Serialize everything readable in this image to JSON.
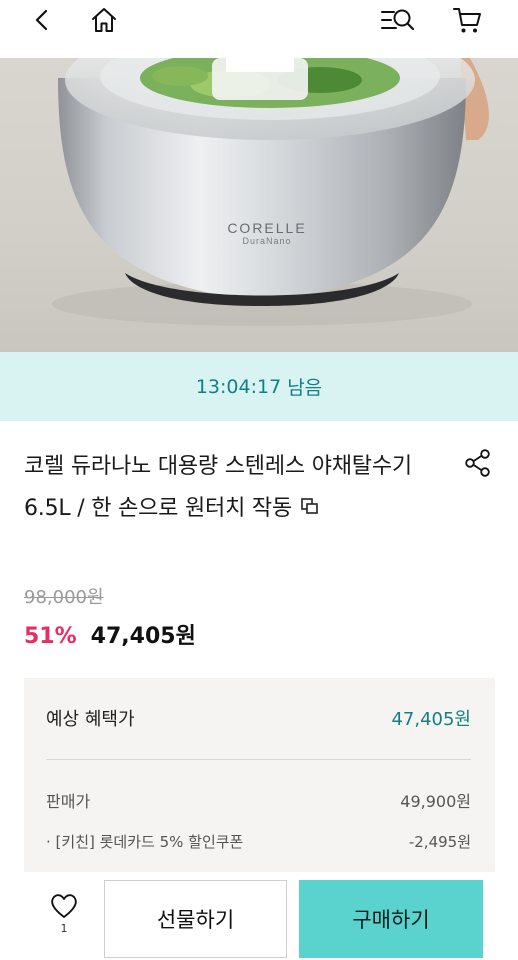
{
  "header": {
    "icons": [
      "back-icon",
      "home-icon",
      "search-menu-icon",
      "cart-icon"
    ]
  },
  "product_image": {
    "brand": "CORELLE",
    "subbrand": "DuraNano"
  },
  "countdown": {
    "time": "13:04:17",
    "suffix": "남음"
  },
  "product": {
    "title": "코렐 듀라나노 대용량 스텐레스 야채탈수기 6.5L / 한 손으로 원터치 작동",
    "original_price": "98,000원",
    "discount_rate": "51%",
    "final_price": "47,405원"
  },
  "benefit": {
    "label": "예상 혜택가",
    "value": "47,405원",
    "rows": [
      {
        "label": "판매가",
        "value": "49,900원"
      },
      {
        "label": "· [키친] 롯데카드 5% 할인쿠폰",
        "value": "-2,495원"
      }
    ]
  },
  "bottom_bar": {
    "like_count": "1",
    "gift_label": "선물하기",
    "buy_label": "구매하기"
  },
  "colors": {
    "accent_teal": "#127f86",
    "buy_button": "#5ad3cf",
    "countdown_bg": "#d9f3f2",
    "discount": "#e52f64"
  }
}
